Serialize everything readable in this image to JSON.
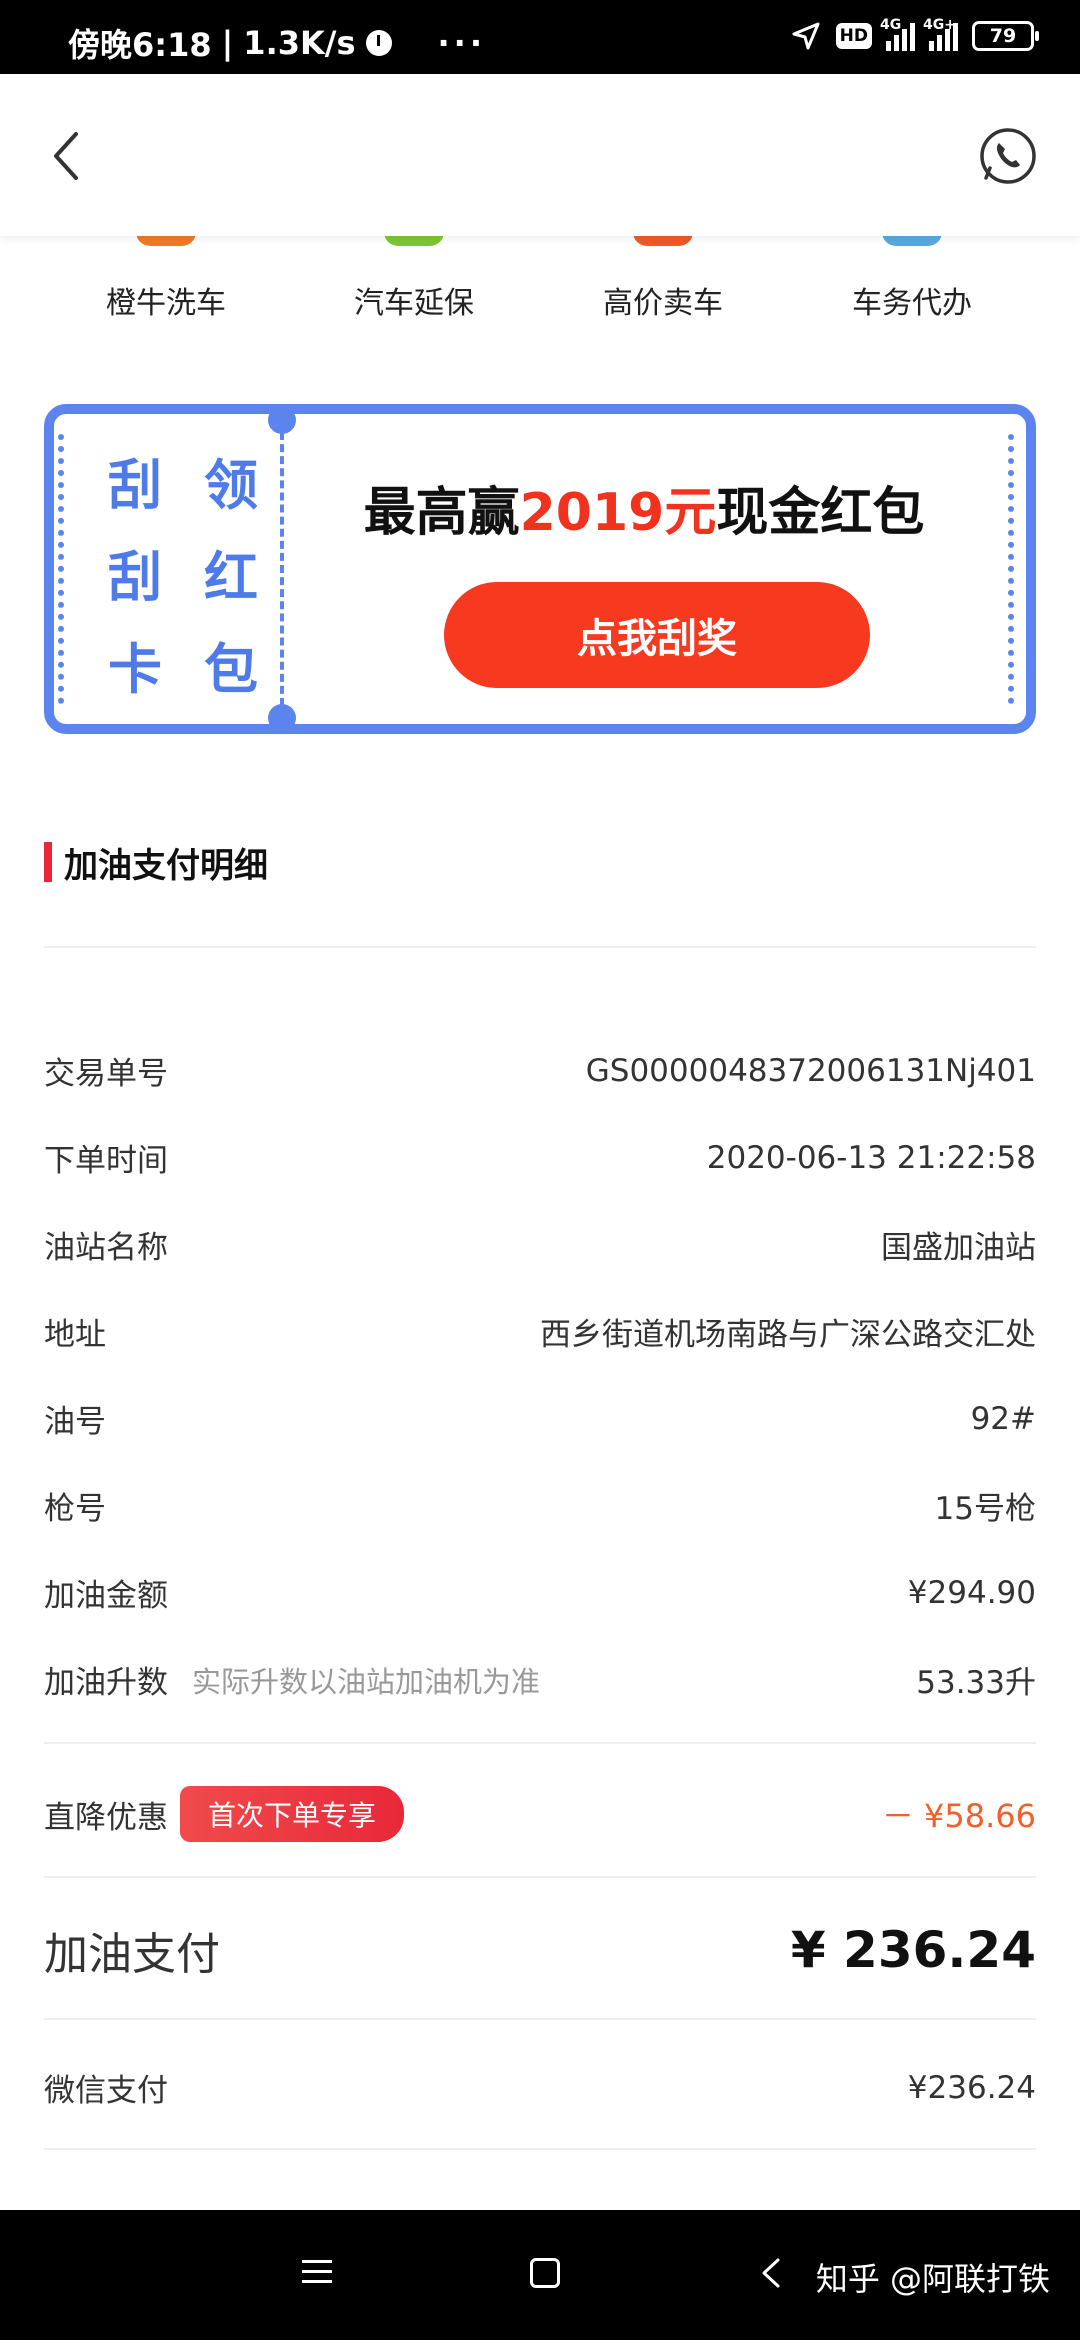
{
  "status_bar": {
    "time": "傍晚6:18",
    "speed": "1.3K/s",
    "dots": "···",
    "hd": "HD",
    "net1": "4G",
    "net2": "4G+",
    "battery": "79"
  },
  "header": {
    "back_icon": "chevron-left-icon",
    "phone_icon": "phone-call-icon"
  },
  "services": [
    {
      "label": "橙牛洗车",
      "color": "#f07a2a"
    },
    {
      "label": "汽车延保",
      "color": "#7cc832"
    },
    {
      "label": "高价卖车",
      "color": "#f05a28"
    },
    {
      "label": "车务代办",
      "color": "#5aa8e0"
    }
  ],
  "promo": {
    "chars": [
      "刮",
      "领",
      "刮",
      "红",
      "卡",
      "包"
    ],
    "title_prefix": "最高赢",
    "title_highlight": "2019元",
    "title_suffix": "现金红包",
    "button_label": "点我刮奖",
    "accent": "#5b84ef",
    "button_color": "#f6391f"
  },
  "section": {
    "title": "加油支付明细",
    "accent": "#e8283a"
  },
  "details": [
    {
      "label": "交易单号",
      "value": "GS0000048372006131Nj401"
    },
    {
      "label": "下单时间",
      "value": "2020-06-13 21:22:58"
    },
    {
      "label": "油站名称",
      "value": "国盛加油站"
    },
    {
      "label": "地址",
      "value": "西乡街道机场南路与广深公路交汇处"
    },
    {
      "label": "油号",
      "value": "92#"
    },
    {
      "label": "枪号",
      "value": "15号枪"
    },
    {
      "label": "加油金额",
      "value": "¥294.90"
    },
    {
      "label": "加油升数",
      "note": "实际升数以油站加油机为准",
      "value": "53.33升"
    }
  ],
  "discount": {
    "label": "直降优惠",
    "badge": "首次下单专享",
    "value": "－ ¥58.66",
    "color": "#f0602a"
  },
  "total": {
    "label": "加油支付",
    "value": "¥ 236.24"
  },
  "payment": {
    "label": "微信支付",
    "value": "¥236.24"
  },
  "watermark": "知乎 @阿联打铁"
}
